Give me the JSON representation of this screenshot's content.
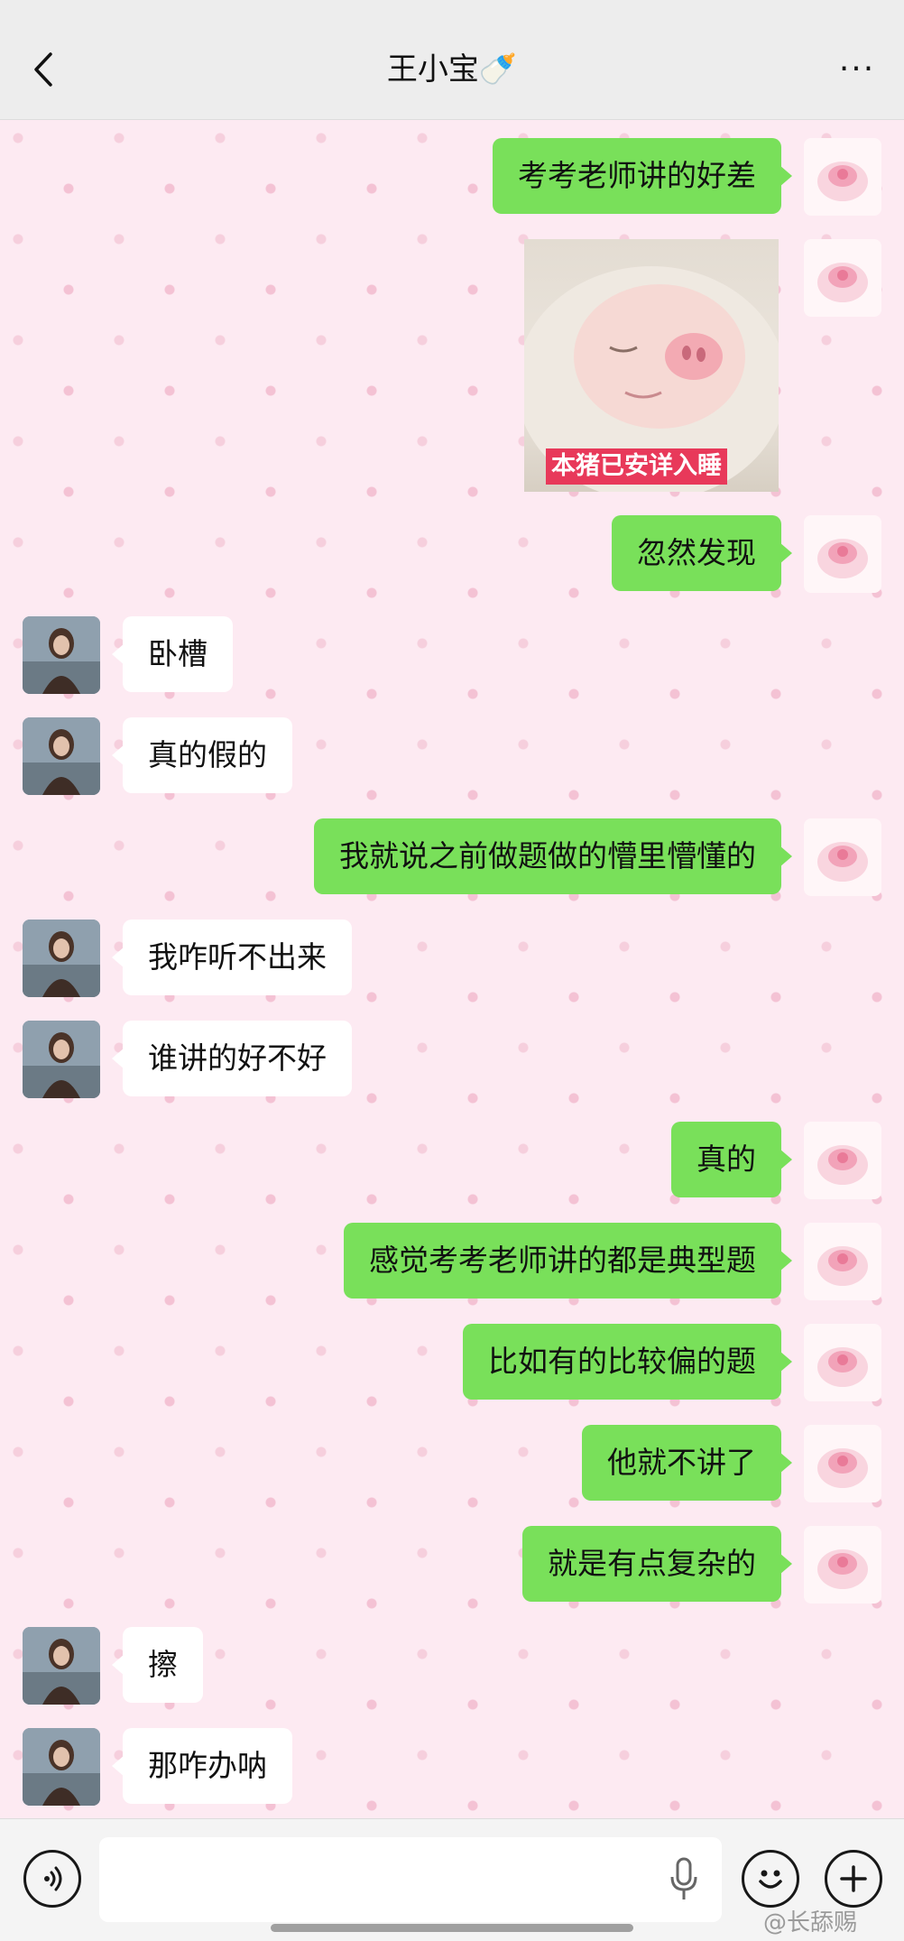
{
  "header": {
    "title": "王小宝🍼",
    "back_icon": "chevron-left-icon",
    "more_label": "···"
  },
  "messages": [
    {
      "side": "me",
      "type": "text",
      "text": "考考老师讲的好差"
    },
    {
      "side": "me",
      "type": "sticker",
      "caption": "本猪已安详入睡"
    },
    {
      "side": "me",
      "type": "text",
      "text": "忽然发现"
    },
    {
      "side": "other",
      "type": "text",
      "text": "卧槽"
    },
    {
      "side": "other",
      "type": "text",
      "text": "真的假的"
    },
    {
      "side": "me",
      "type": "text",
      "text": "我就说之前做题做的懵里懵懂的"
    },
    {
      "side": "other",
      "type": "text",
      "text": "我咋听不出来"
    },
    {
      "side": "other",
      "type": "text",
      "text": "谁讲的好不好"
    },
    {
      "side": "me",
      "type": "text",
      "text": "真的"
    },
    {
      "side": "me",
      "type": "text",
      "text": "感觉考考老师讲的都是典型题"
    },
    {
      "side": "me",
      "type": "text",
      "text": "比如有的比较偏的题"
    },
    {
      "side": "me",
      "type": "text",
      "text": "他就不讲了"
    },
    {
      "side": "me",
      "type": "text",
      "text": "就是有点复杂的"
    },
    {
      "side": "other",
      "type": "text",
      "text": "擦"
    },
    {
      "side": "other",
      "type": "text",
      "text": "那咋办呐"
    }
  ],
  "input_bar": {
    "voice_icon": "voice-mode-icon",
    "mic_icon": "microphone-icon",
    "emoji_icon": "emoji-icon",
    "plus_icon": "plus-icon",
    "plus_label": "+"
  },
  "watermark": "@长舔赐"
}
